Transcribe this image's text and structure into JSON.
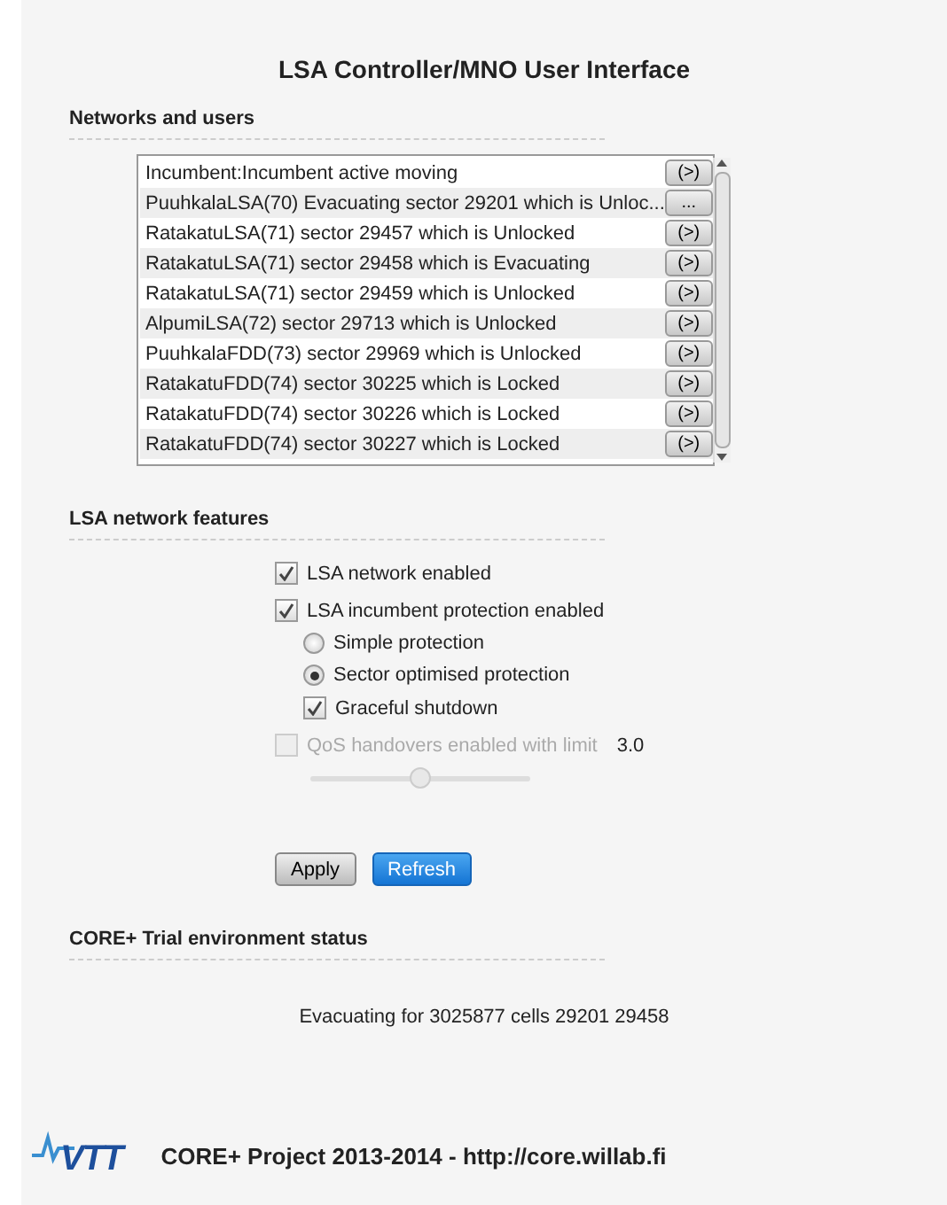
{
  "title": "LSA Controller/MNO User Interface",
  "networks": {
    "heading": "Networks and users",
    "rows": [
      {
        "text": "Incumbent:Incumbent active moving",
        "action": "(>)"
      },
      {
        "text": "PuuhkalaLSA(70) Evacuating sector 29201 which is Unloc...",
        "action": "..."
      },
      {
        "text": "RatakatuLSA(71)  sector 29457 which is Unlocked",
        "action": "(>)"
      },
      {
        "text": "RatakatuLSA(71)  sector 29458 which is Evacuating",
        "action": "(>)"
      },
      {
        "text": "RatakatuLSA(71)  sector 29459 which is Unlocked",
        "action": "(>)"
      },
      {
        "text": "AlpumiLSA(72)  sector 29713 which is Unlocked",
        "action": "(>)"
      },
      {
        "text": "PuuhkalaFDD(73) sector 29969 which is Unlocked",
        "action": "(>)"
      },
      {
        "text": "RatakatuFDD(74) sector 30225 which is Locked",
        "action": "(>)"
      },
      {
        "text": "RatakatuFDD(74) sector 30226 which is Locked",
        "action": "(>)"
      },
      {
        "text": "RatakatuFDD(74) sector 30227 which is Locked",
        "action": "(>)"
      }
    ]
  },
  "features": {
    "heading": "LSA network features",
    "options": [
      {
        "kind": "checkbox",
        "label": "LSA network enabled",
        "checked": true,
        "disabled": false
      },
      {
        "kind": "checkbox",
        "label": "LSA incumbent protection enabled",
        "checked": true,
        "disabled": false,
        "children": [
          {
            "kind": "radio",
            "label": "Simple protection",
            "selected": false
          },
          {
            "kind": "radio",
            "label": "Sector optimised protection",
            "selected": true
          },
          {
            "kind": "checkbox",
            "label": "Graceful shutdown",
            "checked": true,
            "disabled": false
          }
        ]
      },
      {
        "kind": "checkbox",
        "label": "QoS handovers enabled with limit",
        "checked": false,
        "disabled": true,
        "value": "3.0"
      }
    ],
    "slider": {
      "level": 0.5,
      "disabled": true
    },
    "buttons": [
      {
        "label": "Apply",
        "kind": "default"
      },
      {
        "label": "Refresh",
        "kind": "primary"
      }
    ]
  },
  "status": {
    "heading": "CORE+ Trial environment status",
    "message": "Evacuating for 3025877 cells  29201 29458"
  },
  "footer": {
    "logo": "VTT",
    "text": "CORE+ Project 2013-2014 - http://core.willab.fi"
  }
}
